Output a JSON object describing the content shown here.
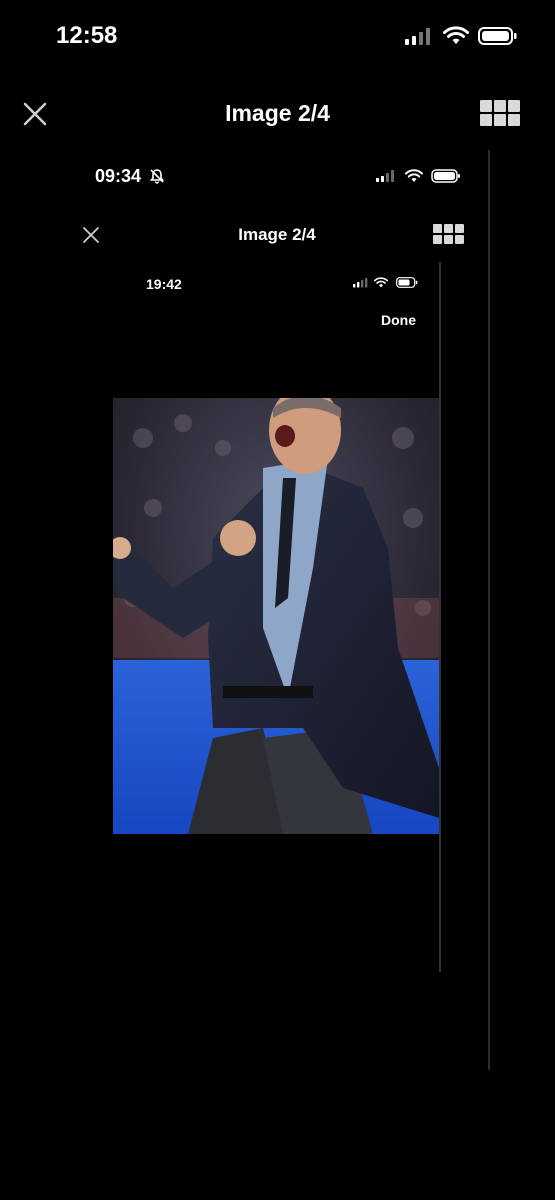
{
  "outer": {
    "status_time": "12:58",
    "title": "Image 2/4",
    "close_icon": "close-icon",
    "grid_icon": "grid-icon"
  },
  "mid": {
    "status_time": "09:34",
    "title": "Image 2/4",
    "mute_icon": "bell-slash-icon"
  },
  "inner": {
    "status_time": "19:42",
    "done_label": "Done"
  },
  "photo": {
    "description_icon": "photo-image"
  }
}
